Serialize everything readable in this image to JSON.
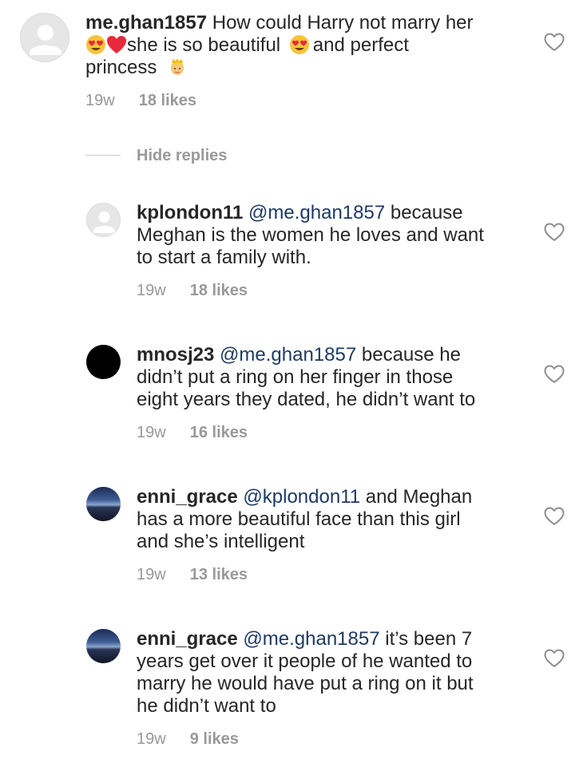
{
  "main_comment": {
    "username": "me.ghan1857",
    "text_line1": "How could Harry not marry her",
    "text_line2_part1": "she is so beautiful",
    "text_line2_part2": "and perfect",
    "text_line3": "princess",
    "time": "19w",
    "likes": "18 likes",
    "emojis": [
      "heart-eyes-emoji",
      "red-heart-emoji",
      "heart-eyes-emoji",
      "princess-emoji"
    ]
  },
  "hide_replies": {
    "label": "Hide replies"
  },
  "replies": [
    {
      "username": "kplondon11",
      "mention": "@me.ghan1857",
      "line1_rest": "because",
      "line2": "Meghan is the women he loves and want",
      "line3": "to start a family with.",
      "time": "19w",
      "likes": "18 likes",
      "avatar": "default-avatar"
    },
    {
      "username": "mnosj23",
      "mention": "@me.ghan1857",
      "line1_rest": "because he",
      "line2": "didn’t put a ring on her finger in those",
      "line3": "eight years they dated, he didn’t want to",
      "time": "19w",
      "likes": "16 likes",
      "avatar": "black-avatar"
    },
    {
      "username": "enni_grace",
      "mention": "@kplondon11",
      "line1_rest": "and Meghan",
      "line2": "has a more beautiful face than this girl",
      "line3": "and she’s intelligent",
      "time": "19w",
      "likes": "13 likes",
      "avatar": "sky-avatar"
    },
    {
      "username": "enni_grace",
      "mention": "@me.ghan1857",
      "line1_rest": "it’s been 7",
      "line2": "years get over it people of he wanted to",
      "line3": "marry he would have put a ring on it but",
      "line4": "he didn’t want to",
      "time": "19w",
      "likes": "9 likes",
      "avatar": "sky-avatar"
    }
  ],
  "colors": {
    "text": "#262626",
    "meta": "#999999",
    "mention": "#1e3a63",
    "heart_outline": "#8e8e8e"
  }
}
